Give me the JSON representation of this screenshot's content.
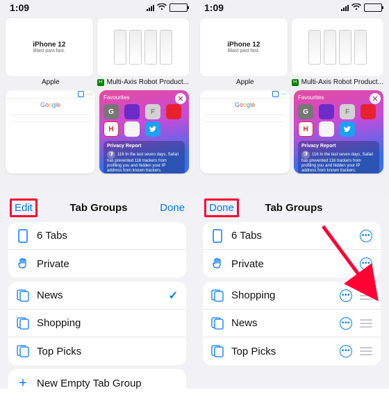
{
  "status": {
    "time": "1:09"
  },
  "thumbs": {
    "apple_title": "iPhone 12",
    "apple_sub": "Blast past fast.",
    "apple_caption": "Apple",
    "robot_caption": "Multi-Axis Robot Product...",
    "fav_marker": "H"
  },
  "google": {
    "letters": [
      "G",
      "o",
      "o",
      "g",
      "l",
      "e"
    ]
  },
  "favcard": {
    "title": "Favourites",
    "privacy_title": "Privacy Report",
    "privacy_text": "In the last seven days, Safari has prevented 116 trackers from profiling you and hidden your IP address from known trackers.",
    "privacy_count": "116"
  },
  "sheet": {
    "title": "Tab Groups",
    "edit": "Edit",
    "done": "Done",
    "tabs_label": "6 Tabs",
    "private_label": "Private",
    "news": "News",
    "shopping": "Shopping",
    "toppicks": "Top Picks",
    "new_empty": "New Empty Tab Group"
  }
}
